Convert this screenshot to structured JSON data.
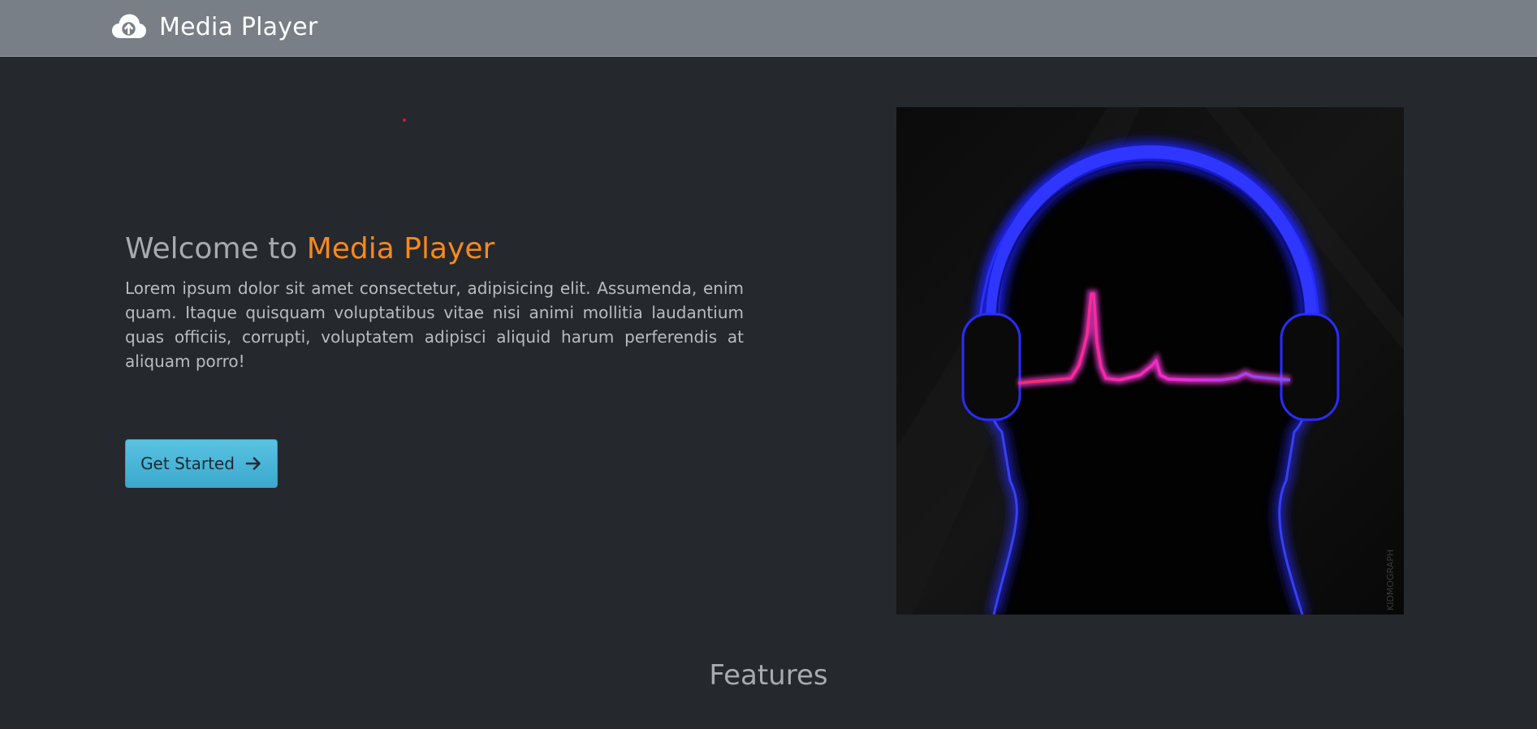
{
  "navbar": {
    "brand_icon": "cloud-upload-icon",
    "brand_label": "Media Player"
  },
  "hero": {
    "title_prefix": "Welcome to ",
    "title_accent": "Media Player",
    "description": "Lorem ipsum dolor sit amet consectetur, adipisicing elit. Assumenda, enim quam. Itaque quisquam voluptatibus vitae nisi animi mollitia laudantium quas officiis, corrupti, voluptatem adipisci aliquid harum perferendis at aliquam porro!",
    "cta_label": "Get Started",
    "cta_icon": "arrow-right-icon",
    "image_icon": "headphones-heartbeat-illustration",
    "image_signature": "KIDMOGRAPH"
  },
  "features": {
    "title": "Features"
  },
  "colors": {
    "navbar": "#787f86",
    "background": "#25282d",
    "accent": "#f7891d",
    "button": "#4bb7d9"
  }
}
